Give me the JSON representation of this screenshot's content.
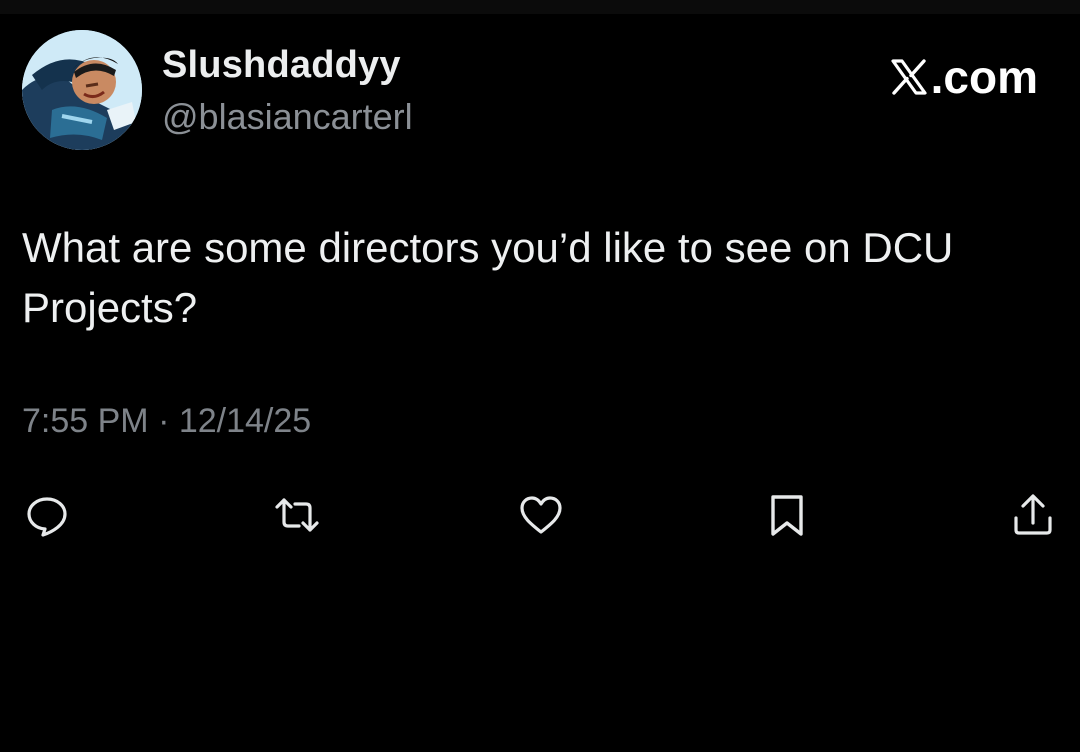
{
  "user": {
    "display_name": "Slushdaddyy",
    "handle": "@blasiancarterl",
    "avatar_icon": "animated-hero-avatar"
  },
  "brand": {
    "label": ".com",
    "icon": "x-logo-icon"
  },
  "tweet": {
    "text": "What are some directors you’d like to see on DCU Projects?",
    "timestamp": "7:55 PM · 12/14/25"
  },
  "actions": [
    {
      "icon": "reply-icon"
    },
    {
      "icon": "repost-icon"
    },
    {
      "icon": "like-icon"
    },
    {
      "icon": "bookmark-icon"
    },
    {
      "icon": "share-icon"
    }
  ],
  "colors": {
    "background": "#000000",
    "text": "#e7e9ea",
    "muted": "#7e8389"
  }
}
